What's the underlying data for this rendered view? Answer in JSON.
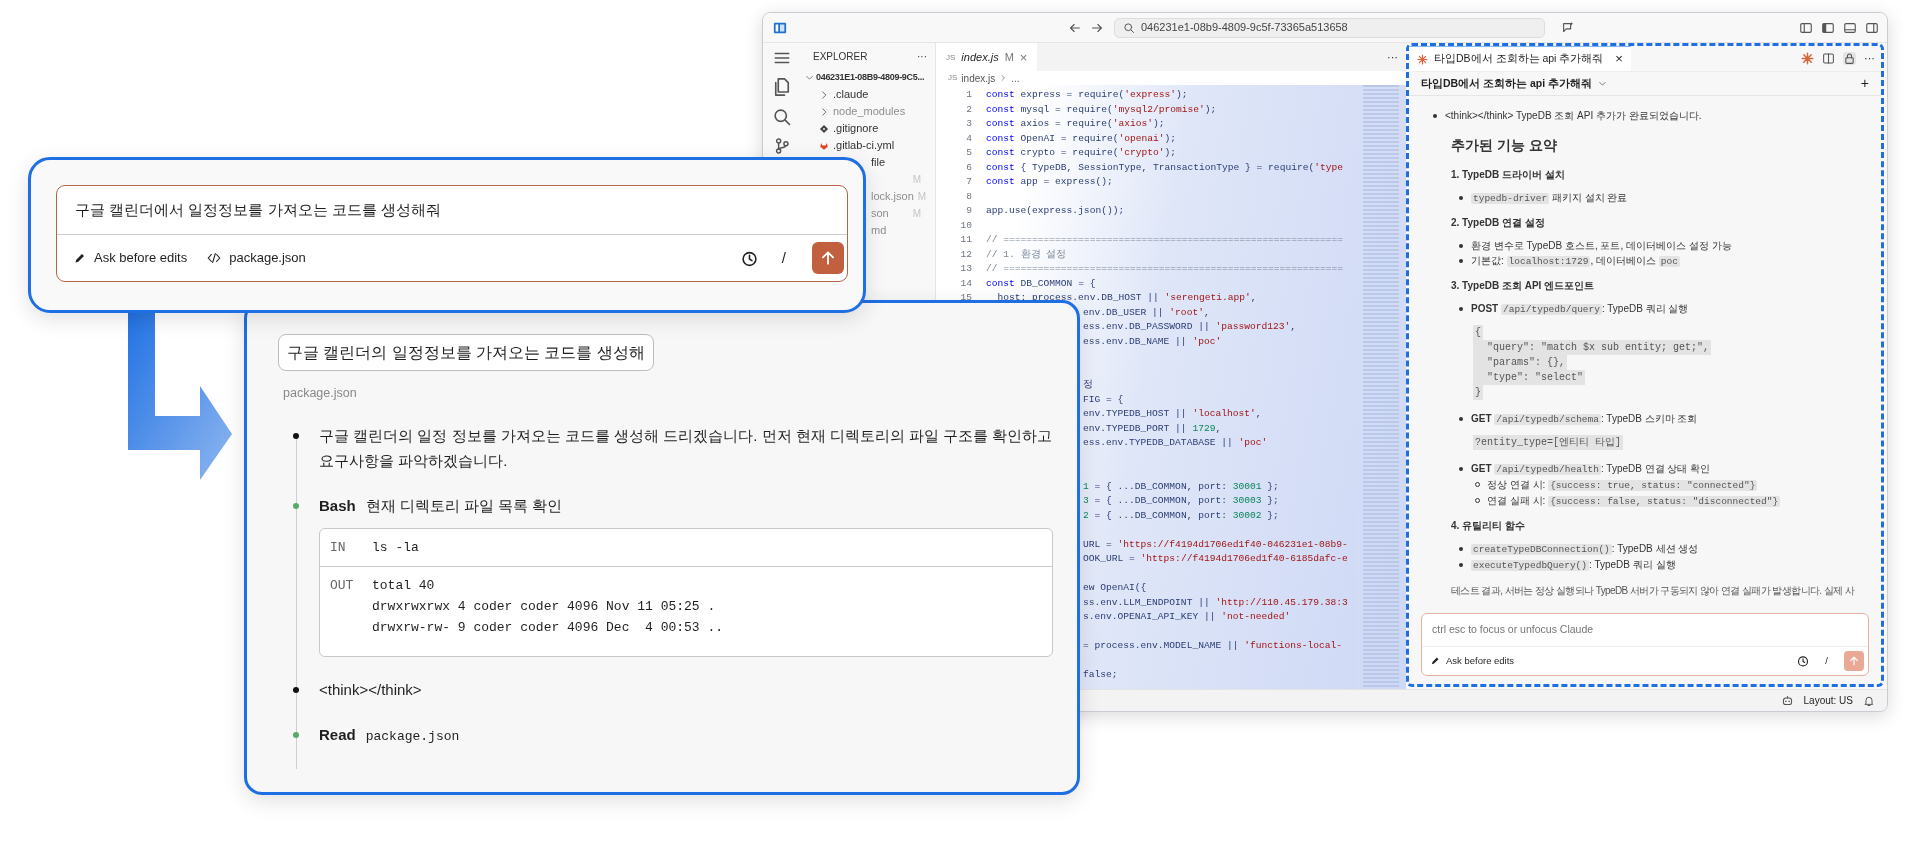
{
  "editor_window": {
    "title_bar": {
      "search_text": "046231e1-08b9-4809-9c5f-73365a513658"
    },
    "explorer": {
      "title": "EXPLORER",
      "more": "···",
      "folder": "046231E1-08B9-4809-9C5...",
      "items": [
        {
          "kind": "folder",
          "name": ".claude",
          "dimmed": false
        },
        {
          "kind": "folder",
          "name": "node_modules",
          "dimmed": true
        },
        {
          "kind": "git",
          "name": ".gitignore",
          "dimmed": false
        },
        {
          "kind": "gitlab",
          "name": ".gitlab-ci.yml",
          "dimmed": false
        },
        {
          "kind": "covered",
          "name": "file",
          "dimmed": false
        },
        {
          "kind": "covered",
          "badge": "M",
          "dimmed": true
        },
        {
          "kind": "covered",
          "name": "lock.json",
          "badge": "M",
          "dimmed": true
        },
        {
          "kind": "covered",
          "name": "son",
          "badge": "M",
          "dimmed": true
        },
        {
          "kind": "covered",
          "name": "md",
          "dimmed": true
        }
      ]
    },
    "editor": {
      "tab": {
        "file_type": "JS",
        "label": "index.js",
        "badge": "M",
        "close": "×"
      },
      "more": "···",
      "breadcrumb": {
        "file_type": "JS",
        "file": "index.js",
        "rest": "..."
      },
      "lines": [
        {
          "number": "1",
          "text": "const express = require('express');"
        },
        {
          "number": "2",
          "text": "const mysql = require('mysql2/promise');"
        },
        {
          "number": "3",
          "text": "const axios = require('axios');"
        },
        {
          "number": "4",
          "text": "const OpenAI = require('openai');"
        },
        {
          "number": "5",
          "text": "const crypto = require('crypto');"
        },
        {
          "number": "6",
          "text": "const { TypeDB, SessionType, TransactionType } = require('type"
        },
        {
          "number": "7",
          "text": "const app = express();"
        },
        {
          "number": "8"
        },
        {
          "number": "9",
          "text": "app.use(express.json());"
        },
        {
          "number": "10"
        },
        {
          "number": "11",
          "text": "// ==========================================================="
        },
        {
          "number": "12",
          "text": "// 1. 환경 설정"
        },
        {
          "number": "13",
          "text": "// ==========================================================="
        },
        {
          "number": "14",
          "text": "const DB_COMMON = {"
        },
        {
          "number": "15",
          "text": "  host: process.env.DB_HOST || 'serengeti.app',"
        }
      ],
      "covered_lines": [
        {
          "kind": "code",
          "text": "env.DB_USER || 'root',"
        },
        {
          "kind": "code",
          "text": "ess.env.DB_PASSWORD || 'password123',"
        },
        {
          "kind": "code",
          "text": "ess.env.DB_NAME || 'poc'"
        },
        {
          "kind": "blank"
        },
        {
          "kind": "blank"
        },
        {
          "kind": "code",
          "text": "정"
        },
        {
          "kind": "code",
          "text": "FIG = {"
        },
        {
          "kind": "code",
          "text": "env.TYPEDB_HOST || 'localhost',"
        },
        {
          "kind": "code",
          "text": "env.TYPEDB_PORT || 1729,"
        },
        {
          "kind": "code",
          "text": "ess.env.TYPEDB_DATABASE || 'poc'"
        },
        {
          "kind": "blank"
        },
        {
          "kind": "blank"
        },
        {
          "kind": "code",
          "text": "1 = { ...DB_COMMON, port: 30001 };"
        },
        {
          "kind": "code",
          "text": "3 = { ...DB_COMMON, port: 30003 };"
        },
        {
          "kind": "code",
          "text": "2 = { ...DB_COMMON, port: 30002 };"
        },
        {
          "kind": "blank"
        },
        {
          "kind": "code",
          "text": "URL = 'https://f4194d1706ed1f40-046231e1-08b9-"
        },
        {
          "kind": "code",
          "text": "OOK_URL = 'https://f4194d1706ed1f40-6185dafc-e"
        },
        {
          "kind": "blank"
        },
        {
          "kind": "code",
          "text": "ew OpenAI({"
        },
        {
          "kind": "code",
          "text": "ss.env.LLM_ENDPOINT || 'http://110.45.179.38:3"
        },
        {
          "kind": "code",
          "text": "s.env.OPENAI_API_KEY || 'not-needed'"
        },
        {
          "kind": "blank"
        },
        {
          "kind": "code",
          "text": "= process.env.MODEL_NAME || 'functions-local-"
        },
        {
          "kind": "blank"
        },
        {
          "kind": "code",
          "text": "false;"
        }
      ]
    },
    "chat_panel": {
      "tab": {
        "label": "타입DB에서 조회하는 api 추가해줘",
        "close": "×"
      },
      "more": "···",
      "session": {
        "title": "타입DB에서 조회하는 api 추가해줘",
        "new": "+"
      },
      "blocks": [
        {
          "kind": "bullet",
          "parts": [
            {
              "kind": "plain",
              "text": "<think></think> TypeDB 조회 API 추가가 완료되었습니다."
            }
          ]
        },
        {
          "kind": "title",
          "text": "추가된 기능 요약"
        },
        {
          "kind": "heading",
          "text": "1. TypeDB 드라이버 설치"
        },
        {
          "kind": "item",
          "parts": [
            {
              "kind": "code",
              "text": "typedb-driver"
            },
            {
              "kind": "plain",
              "text": " 패키지 설치 완료"
            }
          ]
        },
        {
          "kind": "heading",
          "text": "2. TypeDB 연결 설정"
        },
        {
          "kind": "item",
          "parts": [
            {
              "kind": "plain",
              "text": "환경 변수로 TypeDB 호스트, 포트, 데이터베이스 설정 가능"
            }
          ]
        },
        {
          "kind": "item",
          "parts": [
            {
              "kind": "plain",
              "text": "기본값: "
            },
            {
              "kind": "code",
              "text": "localhost:1729"
            },
            {
              "kind": "plain",
              "text": ", 데이터베이스 "
            },
            {
              "kind": "code",
              "text": "poc"
            }
          ]
        },
        {
          "kind": "heading",
          "text": "3. TypeDB 조회 API 엔드포인트"
        },
        {
          "kind": "item",
          "parts": [
            {
              "kind": "bold",
              "text": "POST "
            },
            {
              "kind": "code",
              "text": "/api/typedb/query"
            },
            {
              "kind": "plain",
              "text": ": TypeDB 쿼리 실행"
            }
          ]
        },
        {
          "kind": "code_block",
          "lines": [
            "{",
            "  \"query\": \"match $x sub entity; get;\",",
            "  \"params\": {},",
            "  \"type\": \"select\"",
            "}"
          ]
        },
        {
          "kind": "item",
          "parts": [
            {
              "kind": "bold",
              "text": "GET "
            },
            {
              "kind": "code",
              "text": "/api/typedb/schema"
            },
            {
              "kind": "plain",
              "text": ": TypeDB 스키마 조회"
            }
          ]
        },
        {
          "kind": "code_block",
          "lines": [
            "?entity_type=[엔티티 타입]"
          ]
        },
        {
          "kind": "item",
          "parts": [
            {
              "kind": "bold",
              "text": "GET "
            },
            {
              "kind": "code",
              "text": "/api/typedb/health"
            },
            {
              "kind": "plain",
              "text": ": TypeDB 연결 상태 확인"
            }
          ]
        },
        {
          "kind": "subitem",
          "parts": [
            {
              "kind": "plain",
              "text": "정상 연결 시: "
            },
            {
              "kind": "code",
              "text": "{success: true, status: \"connected\"}"
            }
          ]
        },
        {
          "kind": "subitem",
          "parts": [
            {
              "kind": "plain",
              "text": "연결 실패 시: "
            },
            {
              "kind": "code",
              "text": "{success: false, status: \"disconnected\"}"
            }
          ]
        },
        {
          "kind": "heading",
          "text": "4. 유틸리티 함수"
        },
        {
          "kind": "item",
          "parts": [
            {
              "kind": "code",
              "text": "createTypeDBConnection()"
            },
            {
              "kind": "plain",
              "text": ": TypeDB 세션 생성"
            }
          ]
        },
        {
          "kind": "item",
          "parts": [
            {
              "kind": "code",
              "text": "executeTypedbQuery()"
            },
            {
              "kind": "plain",
              "text": ": TypeDB 쿼리 실행"
            }
          ]
        },
        {
          "kind": "paragraph",
          "parts": [
            {
              "kind": "plain",
              "text": "테스트 결과, 서버는 정상 실행되나 TypeDB 서버가 구동되지 않아 연결 실패가 발생합니다. 실제 사"
            }
          ]
        }
      ],
      "input": {
        "placeholder": "ctrl esc to focus or unfocus Claude",
        "mode": "Ask before edits",
        "slash": "/",
        "send_disabled": true
      }
    },
    "status_bar": {
      "layout": "Layout: US"
    }
  },
  "prompt_card": {
    "value": "구글 캘린더에서 일정정보를 가져오는 코드를 생성해줘",
    "mode": "Ask before edits",
    "context_file": "package.json",
    "slash": "/",
    "send_disabled": false
  },
  "conversation_card": {
    "user_message": "구글 캘린더의 일정정보를 가져오는 코드를 생성해",
    "context_file": "package.json",
    "timeline": [
      {
        "kind": "text",
        "text": "구글 캘린더의 일정 정보를 가져오는 코드를 생성해 드리겠습니다. 먼저 현재 디렉토리의 파일 구조를 확인하고 요구사항을 파악하겠습니다."
      },
      {
        "kind": "tool",
        "tool": "Bash",
        "description": "현재 디렉토리 파일 목록 확인",
        "io": {
          "in_label": "IN",
          "in": "ls -la",
          "out_label": "OUT",
          "out": [
            "total 40",
            "drwxrwxrwx 4 coder coder 4096 Nov 11 05:25 .",
            "drwxrw-rw- 9 coder coder 4096 Dec  4 00:53 .."
          ]
        }
      },
      {
        "kind": "text",
        "text": "<think></think>"
      },
      {
        "kind": "tool",
        "tool": "Read",
        "argument": "package.json"
      }
    ]
  }
}
